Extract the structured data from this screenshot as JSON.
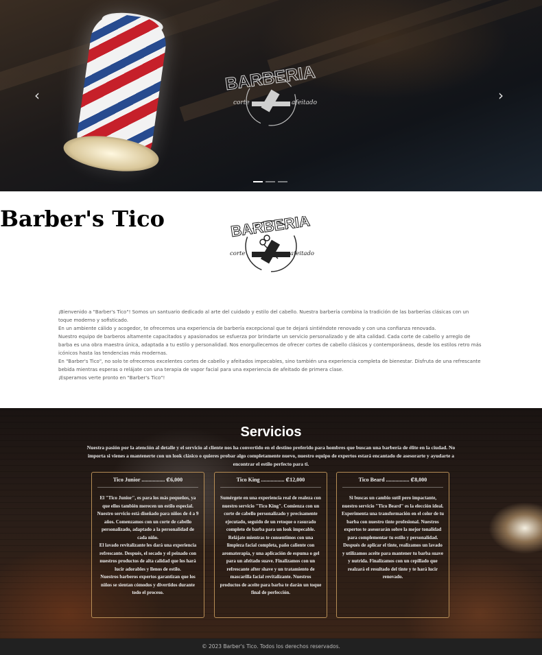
{
  "hero": {
    "prev_arrow": "‹",
    "next_arrow": "›",
    "logo": {
      "word": "BARBERIA",
      "left": "corte",
      "right": "afeitado"
    },
    "slides": 3,
    "active_slide": 1
  },
  "about": {
    "logo": {
      "word": "BARBERIA",
      "left": "corte",
      "right": "afeitado"
    },
    "title": "Barber's Tico",
    "paragraphs": [
      "¡Bienvenido a \"Barber's Tico\"! Somos un santuario dedicado al arte del cuidado y estilo del cabello. Nuestra barbería combina la tradición de las barberías clásicas con un toque moderno y sofisticado.",
      "En un ambiente cálido y acogedor, te ofrecemos una experiencia de barbería excepcional que te dejará sintiéndote renovado y con una confianza renovada.",
      "Nuestro equipo de barberos altamente capacitados y apasionados se esfuerza por brindarte un servicio personalizado y de alta calidad. Cada corte de cabello y arreglo de barba es una obra maestra única, adaptada a tu estilo y personalidad. Nos enorgullecemos de ofrecer cortes de cabello clásicos y contemporáneos, desde los estilos retro más icónicos hasta las tendencias más modernas.",
      "En \"Barber's Tico\", no solo te ofrecemos excelentes cortes de cabello y afeitados impecables, sino también una experiencia completa de bienestar. Disfruta de una refrescante bebida mientras esperas o relájate con una terapia de vapor facial para una experiencia de afeitado de primera clase.",
      "¡Esperamos verte pronto en \"Barber's Tico\"!"
    ]
  },
  "services": {
    "title": "Servicios",
    "intro": "Nuestra pasión por la atención al detalle y el servicio al cliente nos ha convertido en el destino preferido para hombres que buscan una barbería de élite en la ciudad. No importa si vienes a mantenerte con un look clásico o quieres probar algo completamente nuevo, nuestro equipo de expertos estará encantado de asesorarte y ayudarte a encontrar el estilo perfecto para ti.",
    "cards": [
      {
        "title": "Tico Junior ................. ₡6,000",
        "paragraphs": [
          "El \"Tico Junior\", es para los más pequeños, ya que ellos también merecen un estilo especial. Nuestro servicio está diseñado para niños de 4 a 9 años. Comenzamos con un corte de cabello personalizado, adaptado a la personalidad de cada niño.",
          "El lavado revitalizante les dará una experiencia refrescante. Después, el secado y el peinado con nuestros productos de alta calidad que los hará lucir adorables y llenos de estilo.",
          "Nuestros barberos expertos garantizan que los niños se sientan cómodos y divertidos durante todo el proceso."
        ]
      },
      {
        "title": "Tico King ................. ₡12,000",
        "paragraphs": [
          "Sumérgete en una experiencia real de realeza con nuestro servicio \"Tico King\". Comienza con un corte de cabello personalizado y precisamente ejecutado, seguido de un retoque o rasurado completo de barba para un look impecable. Relájate mientras te consentimos con una limpieza facial completa, paño caliente con aromaterapia, y una aplicación de espuma o gel para un afeitado suave. Finalizamos con un refrescante after shave y un tratamiento de mascarilla facial revitalizante. Nuestros productos de aceite para barba te darán un toque final de perfección."
        ]
      },
      {
        "title": "Tico Beard ................. ₡8,000",
        "paragraphs": [
          "Si buscas un cambio sutil pero impactante, nuestro servicio \"Tico Beard\" es la elección ideal. Experimenta una transformación en el color de tu barba con nuestro tinte profesional. Nuestros expertos te asesorarán sobre la mejor tonalidad para complementar tu estilo y personalidad.",
          "Después de aplicar el tinte, realizamos un lavado y utilizamos aceite para mantener tu barba suave y nutrida. Finalizamos con un cepillado que realzará el resultado del tinte y te hará lucir renovado."
        ]
      }
    ]
  },
  "footer": {
    "text": "© 2023 Barber's Tico. Todos los derechos reservados."
  }
}
